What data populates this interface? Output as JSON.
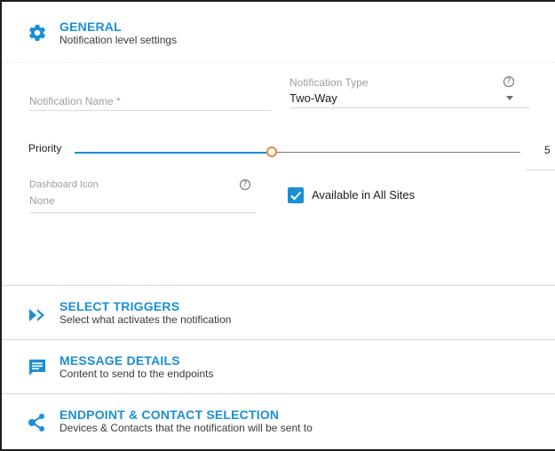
{
  "general": {
    "title": "GENERAL",
    "subtitle": "Notification level settings",
    "icon": "gear-icon"
  },
  "form": {
    "notification_name": {
      "label": "Notification Name *",
      "value": ""
    },
    "notification_type": {
      "label": "Notification Type",
      "value": "Two-Way",
      "help": "?"
    },
    "priority": {
      "label": "Priority",
      "value": "5",
      "level_fraction": 0.5
    },
    "dashboard_icon": {
      "label": "Dashboard Icon",
      "value": "None",
      "help": "?"
    },
    "available_all_sites": {
      "label": "Available in All Sites",
      "checked": true
    }
  },
  "sections": [
    {
      "title": "SELECT TRIGGERS",
      "subtitle": "Select what activates the notification",
      "icon": "double-chevron-right-icon"
    },
    {
      "title": "MESSAGE DETAILS",
      "subtitle": "Content to send to the endpoints",
      "icon": "message-icon"
    },
    {
      "title": "ENDPOINT & CONTACT SELECTION",
      "subtitle": "Devices & Contacts that the notification will be sent to",
      "icon": "share-nodes-icon"
    }
  ],
  "colors": {
    "accent": "#1a8fd6",
    "slider_thumb": "#e8873a"
  }
}
